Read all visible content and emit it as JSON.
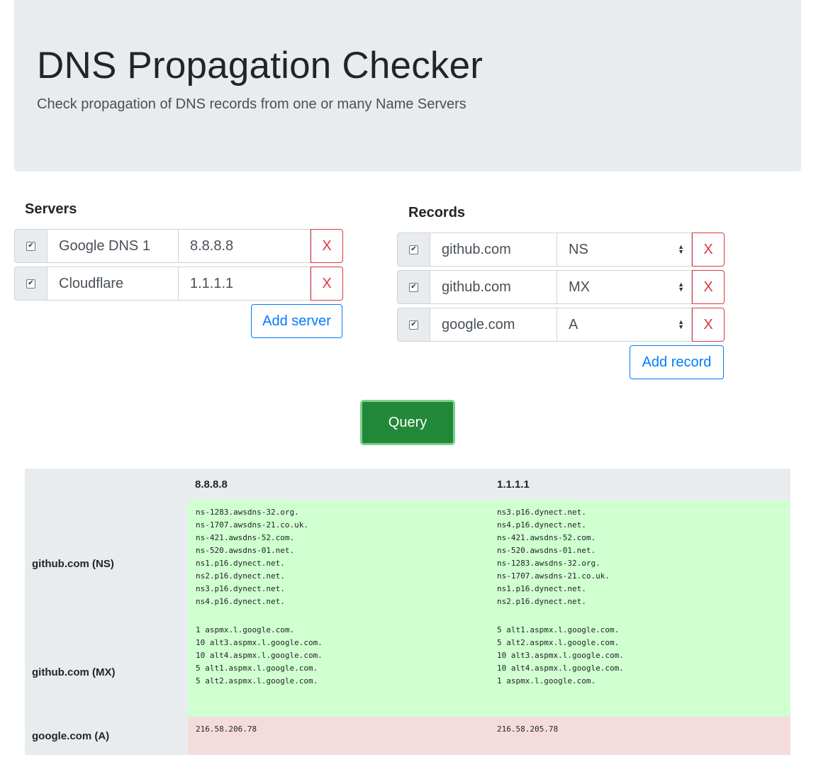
{
  "header": {
    "title": "DNS Propagation Checker",
    "subtitle": "Check propagation of DNS records from one or many Name Servers"
  },
  "servers": {
    "title": "Servers",
    "items": [
      {
        "checked": true,
        "name": "Google DNS 1",
        "address": "8.8.8.8",
        "remove_label": "X"
      },
      {
        "checked": true,
        "name": "Cloudflare",
        "address": "1.1.1.1",
        "remove_label": "X"
      }
    ],
    "add_label": "Add server"
  },
  "records": {
    "title": "Records",
    "items": [
      {
        "checked": true,
        "domain": "github.com",
        "type": "NS",
        "remove_label": "X"
      },
      {
        "checked": true,
        "domain": "github.com",
        "type": "MX",
        "remove_label": "X"
      },
      {
        "checked": true,
        "domain": "google.com",
        "type": "A",
        "remove_label": "X"
      }
    ],
    "add_label": "Add record"
  },
  "query_label": "Query",
  "results": {
    "columns": [
      "8.8.8.8",
      "1.1.1.1"
    ],
    "rows": [
      {
        "label": "github.com (NS)",
        "status": "match",
        "cells": [
          "ns-1283.awsdns-32.org.\nns-1707.awsdns-21.co.uk.\nns-421.awsdns-52.com.\nns-520.awsdns-01.net.\nns1.p16.dynect.net.\nns2.p16.dynect.net.\nns3.p16.dynect.net.\nns4.p16.dynect.net.",
          "ns3.p16.dynect.net.\nns4.p16.dynect.net.\nns-421.awsdns-52.com.\nns-520.awsdns-01.net.\nns-1283.awsdns-32.org.\nns-1707.awsdns-21.co.uk.\nns1.p16.dynect.net.\nns2.p16.dynect.net."
        ]
      },
      {
        "label": "github.com (MX)",
        "status": "match",
        "cells": [
          "1 aspmx.l.google.com.\n10 alt3.aspmx.l.google.com.\n10 alt4.aspmx.l.google.com.\n5 alt1.aspmx.l.google.com.\n5 alt2.aspmx.l.google.com.",
          "5 alt1.aspmx.l.google.com.\n5 alt2.aspmx.l.google.com.\n10 alt3.aspmx.l.google.com.\n10 alt4.aspmx.l.google.com.\n1 aspmx.l.google.com."
        ]
      },
      {
        "label": "google.com (A)",
        "status": "mismatch",
        "cells": [
          "216.58.206.78",
          "216.58.205.78"
        ]
      }
    ]
  },
  "colors": {
    "match": "#d0ffd0",
    "mismatch": "#f5dcdc",
    "primary": "#007bff",
    "danger": "#dc3545",
    "success": "#218838"
  }
}
